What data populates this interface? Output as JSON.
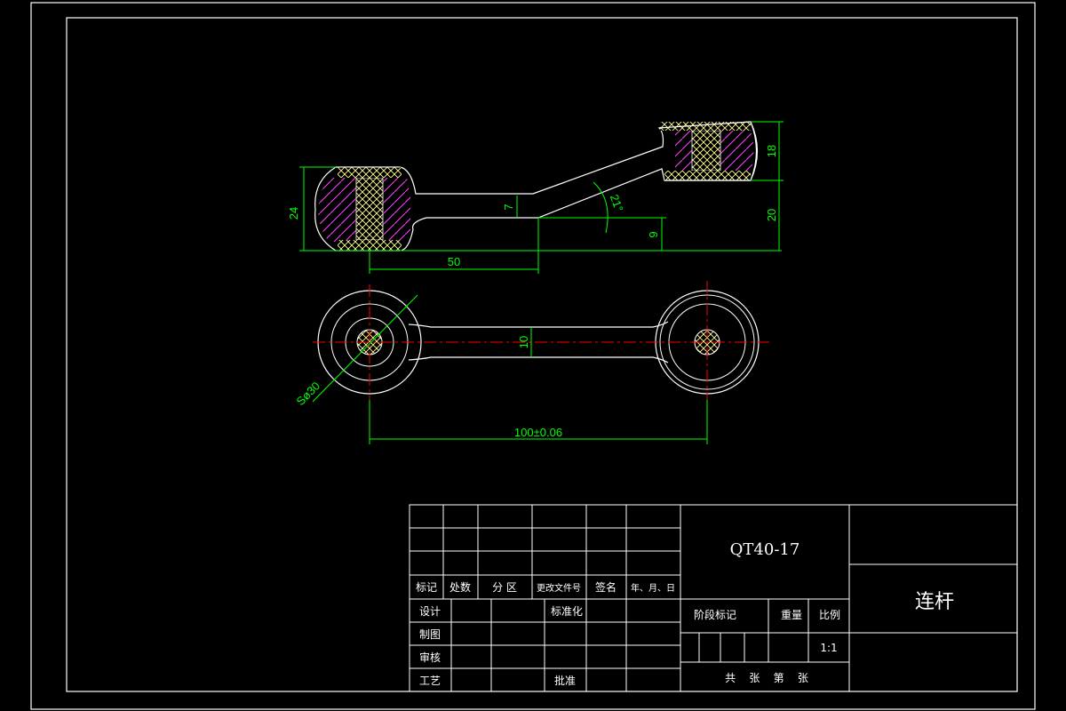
{
  "drawing": {
    "dimensions": {
      "d24": "24",
      "d7": "7",
      "d21deg": "21°",
      "d9": "9",
      "d18": "18",
      "d20": "20",
      "d50": "50",
      "d10": "10",
      "dS30": "Sø30",
      "d100": "100±0.06"
    }
  },
  "title_block": {
    "rev_headers": [
      "标记",
      "处数",
      "分 区",
      "更改文件号",
      "签名",
      "年、月、日"
    ],
    "roles": [
      "设计",
      "制图",
      "审核",
      "工艺"
    ],
    "std_label": "标准化",
    "approve_label": "批准",
    "material": "QT40-17",
    "stage_label": "阶段标记",
    "weight_label": "重量",
    "scale_label": "比例",
    "scale_value": "1:1",
    "sheets_label": "共    张    第    张",
    "part_name": "连杆"
  },
  "colors": {
    "background": "#000000",
    "outline": "#ffffff",
    "dimension": "#00ff00",
    "centerline": "#ff0000",
    "hatch_section": "#ffff99",
    "hatch_body": "#ff00ff"
  }
}
